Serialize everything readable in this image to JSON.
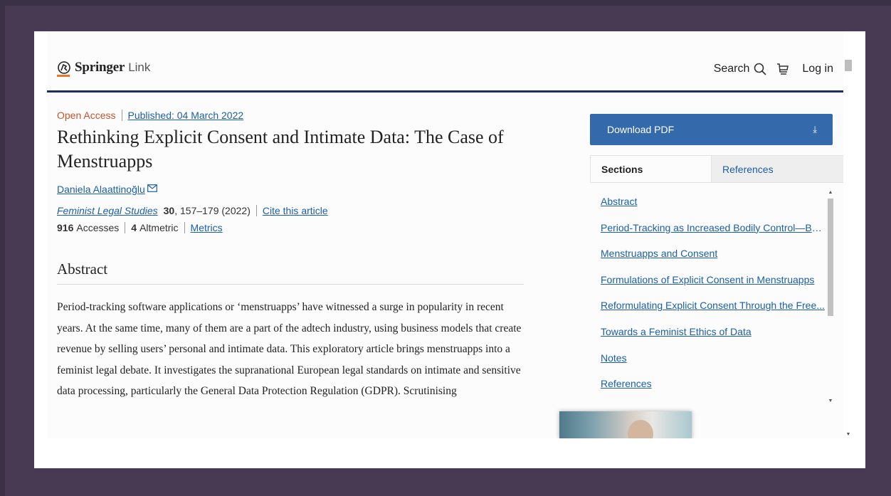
{
  "header": {
    "logo_springer": "Springer",
    "logo_link": "Link",
    "search_label": "Search",
    "login_label": "Log in"
  },
  "article": {
    "access": "Open Access",
    "published": "Published: 04 March 2022",
    "title": "Rethinking Explicit Consent and Intimate Data: The Case of Menstruapps",
    "author": "Daniela Alaattinoğlu",
    "journal": "Feminist Legal Studies",
    "volume": "30",
    "pages": ", 157–179 (2022)",
    "cite": "Cite this article",
    "accesses_count": "916",
    "accesses_label": "Accesses",
    "altmetric_count": "4",
    "altmetric_label": "Altmetric",
    "metrics_link": "Metrics",
    "abstract_heading": "Abstract",
    "abstract_text": "Period-tracking software applications or ‘menstruapps’ have witnessed a surge in popularity in recent years. At the same time, many of them are a part of the adtech industry, using business models that create revenue by selling users’ personal and intimate data. This exploratory article brings menstruapps into a feminist legal debate. It investigates the supranational European legal standards on intimate and sensitive data processing, particularly the General Data Protection Regulation (GDPR). Scrutinising"
  },
  "sidebar": {
    "download_label": "Download PDF",
    "download_icon": "download-arrow-icon",
    "tabs": [
      {
        "label": "Sections"
      },
      {
        "label": "References"
      }
    ],
    "toc": [
      {
        "label": "Abstract"
      },
      {
        "label": "Period-Tracking as Increased Bodily Control—But..."
      },
      {
        "label": "Menstruapps and Consent"
      },
      {
        "label": "Formulations of Explicit Consent in Menstruapps"
      },
      {
        "label": "Reformulating Explicit Consent Through the Free..."
      },
      {
        "label": "Towards a Feminist Ethics of Data"
      },
      {
        "label": "Notes"
      },
      {
        "label": "References"
      }
    ]
  },
  "colors": {
    "brand_navy": "#1d2f5e",
    "accent_orange": "#e87722",
    "download_blue": "#346aab",
    "link_blue": "#1a5fa8",
    "open_access": "#c4532c"
  }
}
